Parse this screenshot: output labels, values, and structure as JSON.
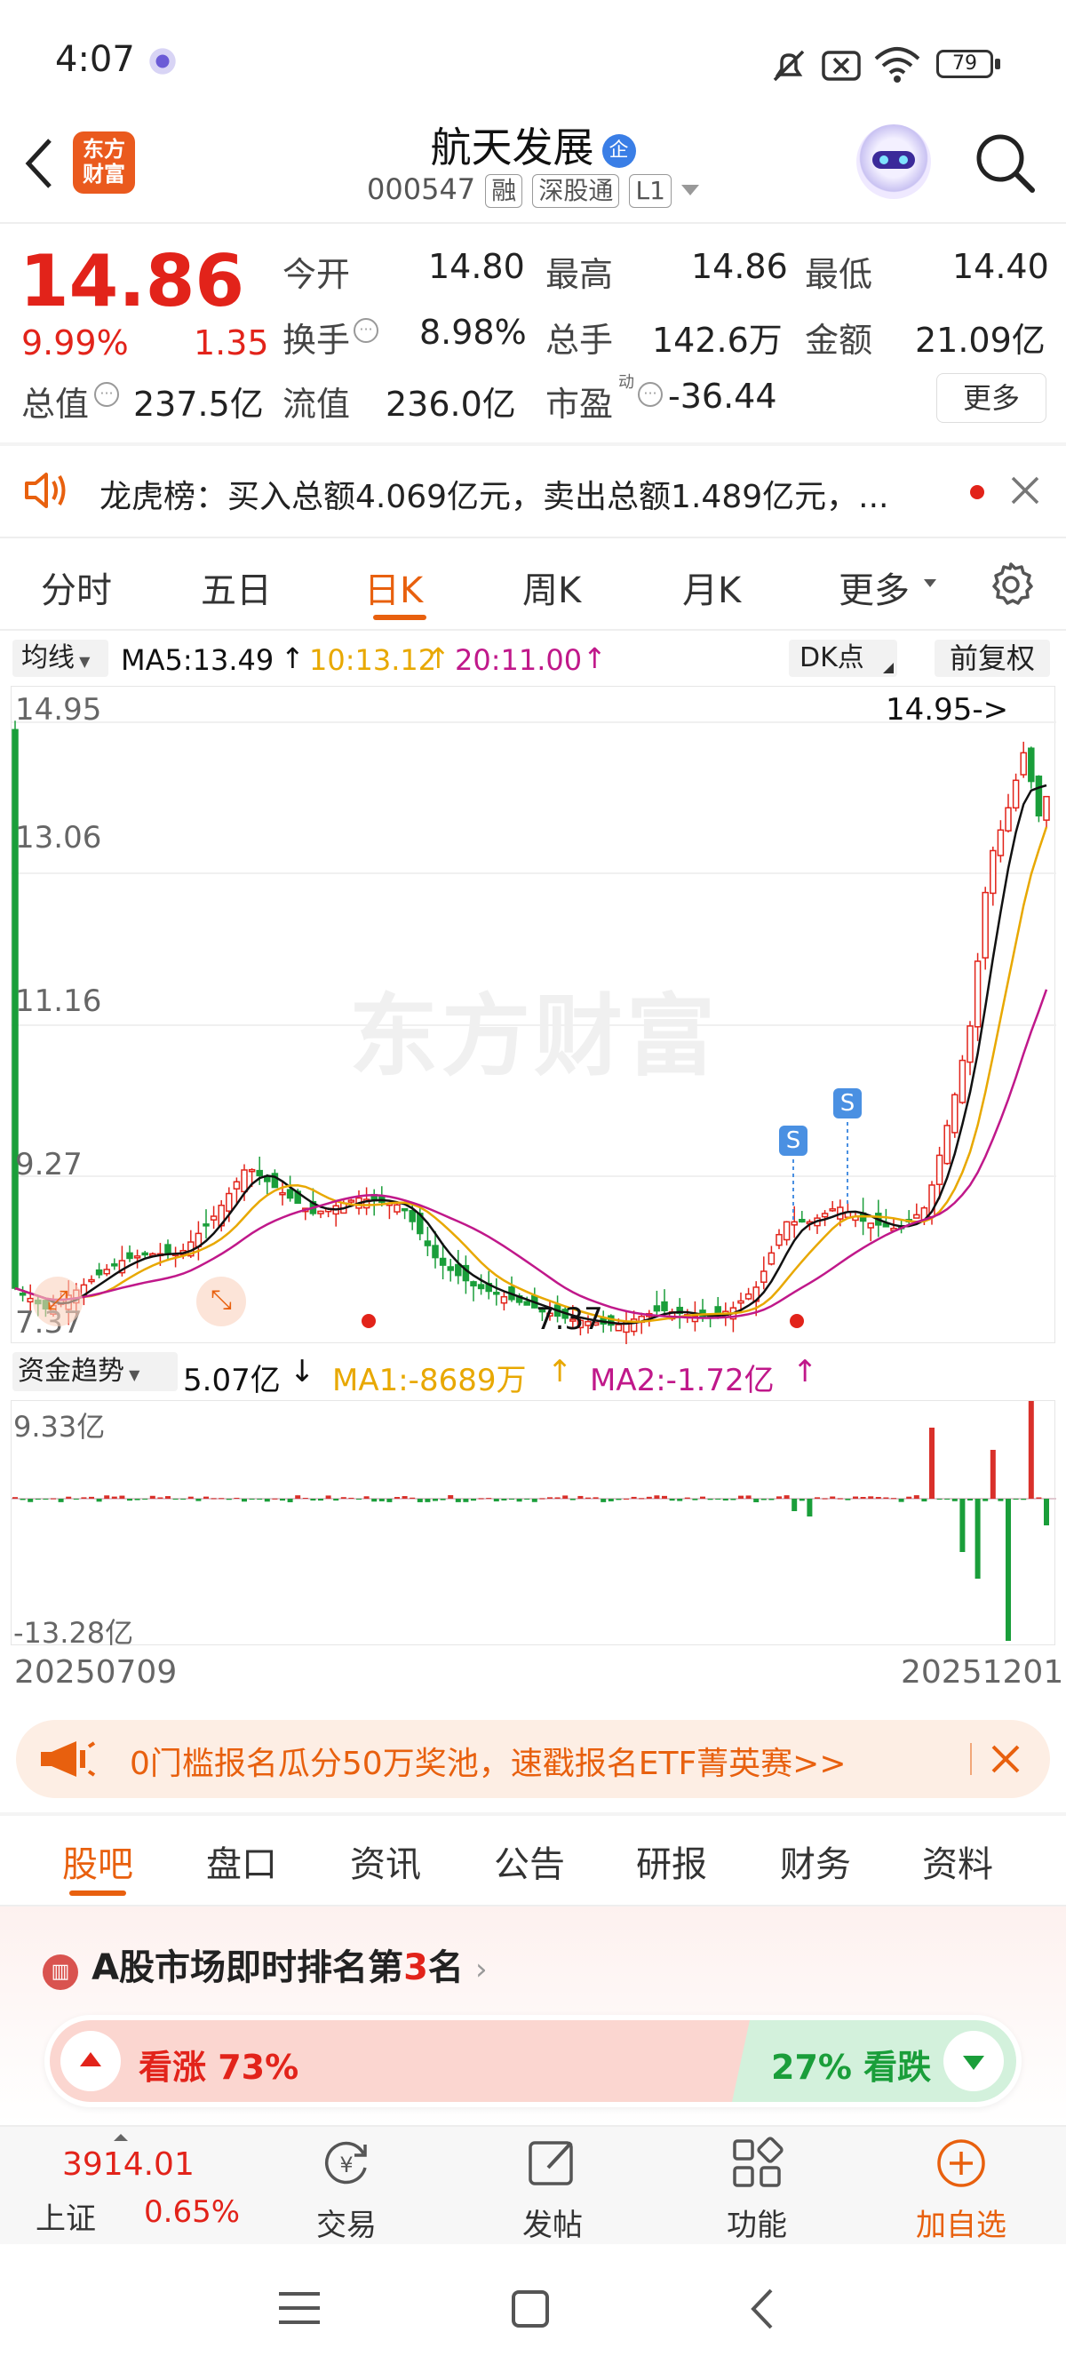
{
  "status_bar": {
    "time": "4:07",
    "battery": "79"
  },
  "header": {
    "logo_text": "东方\n财富",
    "title": "航天发展",
    "title_badge": "企",
    "code": "000547",
    "chips": [
      "融",
      "深股通",
      "L1"
    ]
  },
  "quote": {
    "price": "14.86",
    "change_pct": "9.99%",
    "change_amt": "1.35",
    "fields": [
      {
        "label": "今开",
        "value": "14.80"
      },
      {
        "label": "最高",
        "value": "14.86"
      },
      {
        "label": "最低",
        "value": "14.40"
      },
      {
        "label": "换手",
        "value": "8.98%"
      },
      {
        "label": "总手",
        "value": "142.6万"
      },
      {
        "label": "金额",
        "value": "21.09亿"
      },
      {
        "label": "总值",
        "value": "237.5亿"
      },
      {
        "label": "流值",
        "value": "236.0亿"
      },
      {
        "label": "市盈",
        "value": "-36.44",
        "sup": "动"
      }
    ],
    "more_button": "更多"
  },
  "notice": {
    "text": "龙虎榜：买入总额4.069亿元，卖出总额1.489亿元，..."
  },
  "chart_tabs": [
    "分时",
    "五日",
    "日K",
    "周K",
    "月K",
    "更多"
  ],
  "chart_active_tab": "日K",
  "ma_bar": {
    "selector": "均线",
    "ma5": "MA5:13.49",
    "ma10": "10:13.12",
    "ma20": "20:11.00",
    "dk_button": "DK点",
    "fq_button": "前复权"
  },
  "price_axis": [
    "14.95",
    "13.06",
    "11.16",
    "9.27",
    "7.37"
  ],
  "price_annotations": {
    "high_marker": "14.95->",
    "low_marker": "7.37",
    "signal_letter": "S"
  },
  "watermark": "东方财富",
  "fund_bar": {
    "selector": "资金趋势",
    "value": "5.07亿",
    "ma1": "MA1:-8689万",
    "ma2": "MA2:-1.72亿"
  },
  "fund_axis": {
    "top": "9.33亿",
    "bottom": "-13.28亿"
  },
  "date_range": {
    "start": "20250709",
    "end": "20251201"
  },
  "promo": {
    "text": "0门槛报名瓜分50万奖池，速戳报名ETF菁英赛>>"
  },
  "section_tabs": [
    "股吧",
    "盘口",
    "资讯",
    "公告",
    "研报",
    "财务",
    "资料"
  ],
  "section_active_tab": "股吧",
  "ranking": {
    "prefix": "A股市场即时排名第",
    "rank": "3",
    "suffix": "名"
  },
  "sentiment": {
    "up_label": "看涨 73%",
    "down_label": "27% 看跌",
    "up_pct": 73
  },
  "bottom_nav": {
    "index_value": "3914.01",
    "index_name": "上证",
    "index_change": "0.65%",
    "items": [
      {
        "label": "交易"
      },
      {
        "label": "发帖"
      },
      {
        "label": "功能"
      },
      {
        "label": "加自选"
      }
    ]
  },
  "colors": {
    "red": "#e2231a",
    "green": "#1a9e3a",
    "accent": "#e8600e",
    "ma5": "#111111",
    "ma10": "#e8a800",
    "ma20": "#c0188a"
  }
}
